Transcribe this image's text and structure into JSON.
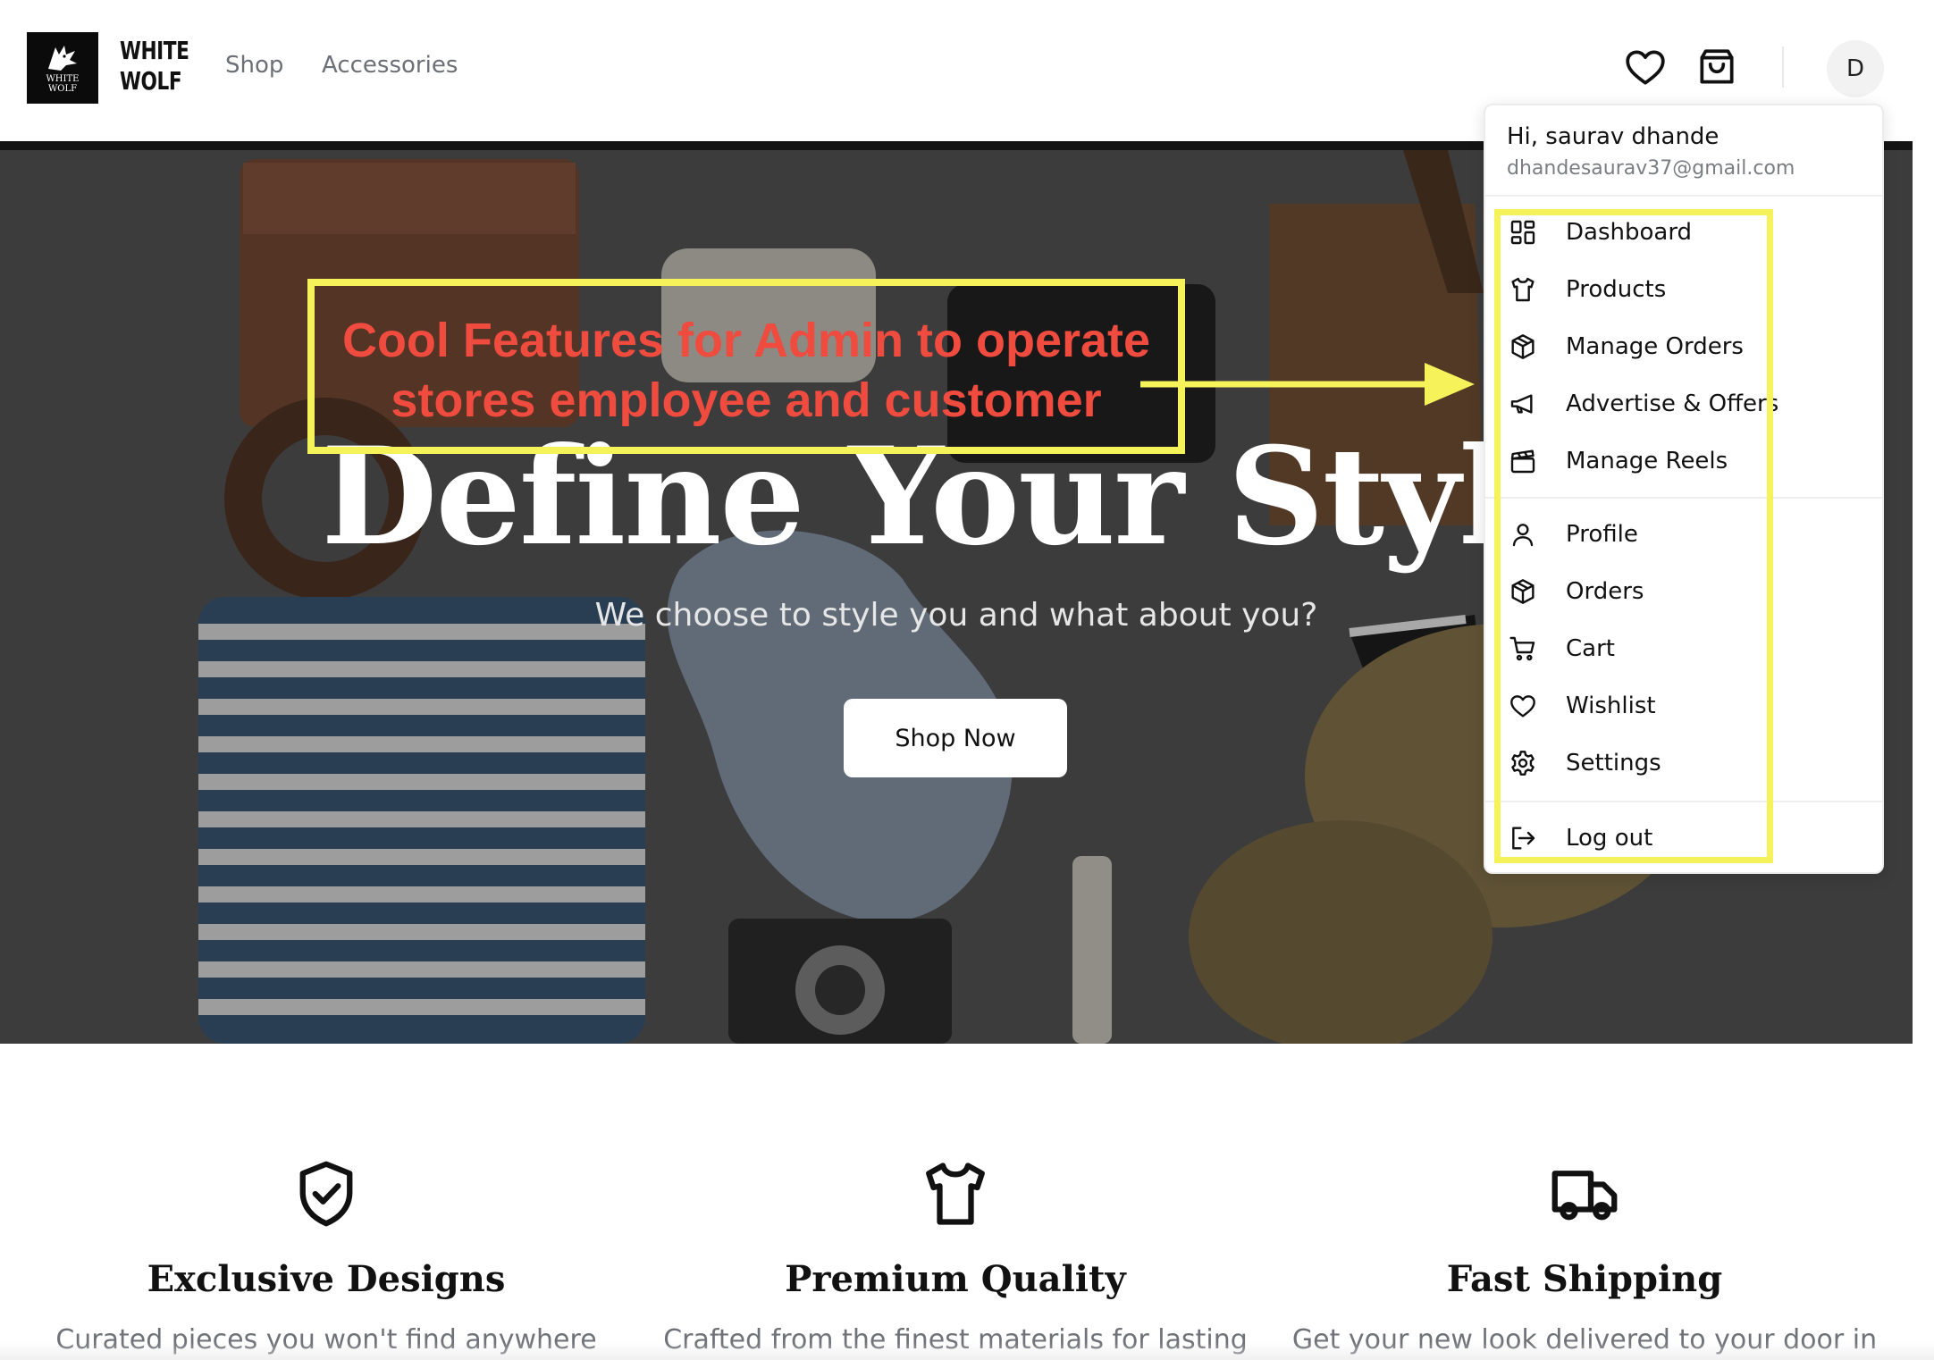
{
  "header": {
    "logo_text": "WHITE WOLF",
    "brand_line1": "WHITE",
    "brand_line2": "WOLF",
    "nav": [
      {
        "label": "Shop"
      },
      {
        "label": "Accessories"
      }
    ],
    "icons": [
      "heart-icon",
      "shopping-bag-icon"
    ],
    "avatar_initial": "D"
  },
  "hero": {
    "title": "Define Your Style",
    "subtitle": "We choose to style you and what about you?",
    "cta_label": "Shop Now"
  },
  "annotation": {
    "line1": "Cool Features for Admin to operate",
    "line2": "stores employee and customer",
    "color": "#f6f35a",
    "text_color": "#ef4b3e"
  },
  "user_menu": {
    "greeting": "Hi, saurav dhande",
    "email": "dhandesaurav37@gmail.com",
    "admin_items": [
      {
        "label": "Dashboard",
        "icon": "dashboard-icon"
      },
      {
        "label": "Products",
        "icon": "shirt-icon"
      },
      {
        "label": "Manage Orders",
        "icon": "box-icon"
      },
      {
        "label": "Advertise & Offers",
        "icon": "megaphone-icon"
      },
      {
        "label": "Manage Reels",
        "icon": "clapperboard-icon"
      }
    ],
    "user_items": [
      {
        "label": "Profile",
        "icon": "user-icon"
      },
      {
        "label": "Orders",
        "icon": "box-icon"
      },
      {
        "label": "Cart",
        "icon": "cart-icon"
      },
      {
        "label": "Wishlist",
        "icon": "heart-icon"
      },
      {
        "label": "Settings",
        "icon": "gear-icon"
      }
    ],
    "logout_label": "Log out"
  },
  "features": [
    {
      "title": "Exclusive Designs",
      "description": "Curated pieces you won't find anywhere",
      "icon": "shield-check-icon"
    },
    {
      "title": "Premium Quality",
      "description": "Crafted from the finest materials for lasting",
      "icon": "shirt-icon"
    },
    {
      "title": "Fast Shipping",
      "description": "Get your new look delivered to your door in",
      "icon": "truck-icon"
    }
  ]
}
